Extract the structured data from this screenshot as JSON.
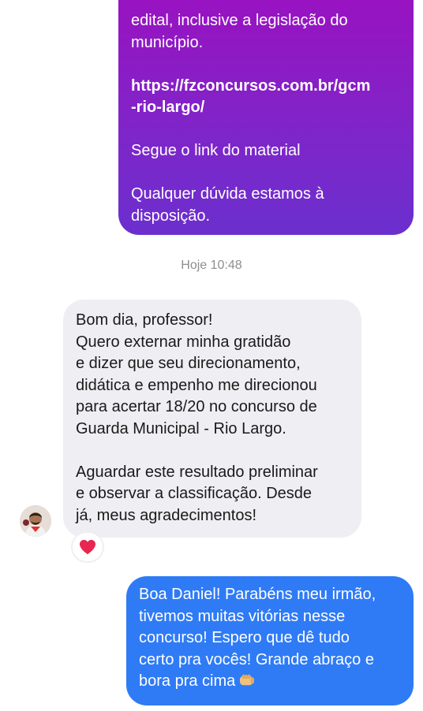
{
  "sent_message_1": {
    "line_1": "edital, inclusive a legislação do",
    "line_2": "município.",
    "link_line_1": "https://fzconcursos.com.br/gcm",
    "link_line_2": "-rio-largo/",
    "line_3": "Segue o link do material",
    "line_4": "Qualquer dúvida estamos à",
    "line_5": "disposição."
  },
  "timestamp": "Hoje 10:48",
  "received_message": {
    "paragraph_1": "Bom dia, professor!\nQuero externar minha gratidão\ne dizer que seu direcionamento,\ndidática e empenho me direcionou\npara acertar 18/20 no concurso de\nGuarda Municipal - Rio Largo.",
    "paragraph_2": "Aguardar este resultado preliminar\ne observar a classificação. Desde\njá, meus agradecimentos!",
    "reaction_icon": "heart-icon"
  },
  "sent_message_2": {
    "text": "Boa Daniel! Parabéns meu irmão,\ntivemos muitas vitórias nesse\nconcurso! Espero que dê tudo\ncerto pra vocês! Grande abraço e\nbora pra cima",
    "emoji_icon": "fist-bump-icon"
  },
  "colors": {
    "sent_gradient_top": "#9d0fbf",
    "sent_gradient_bottom": "#6b2fce",
    "received_bg": "#efeff3",
    "sent_blue": "#2f7bf6",
    "heart": "#e8264f"
  }
}
